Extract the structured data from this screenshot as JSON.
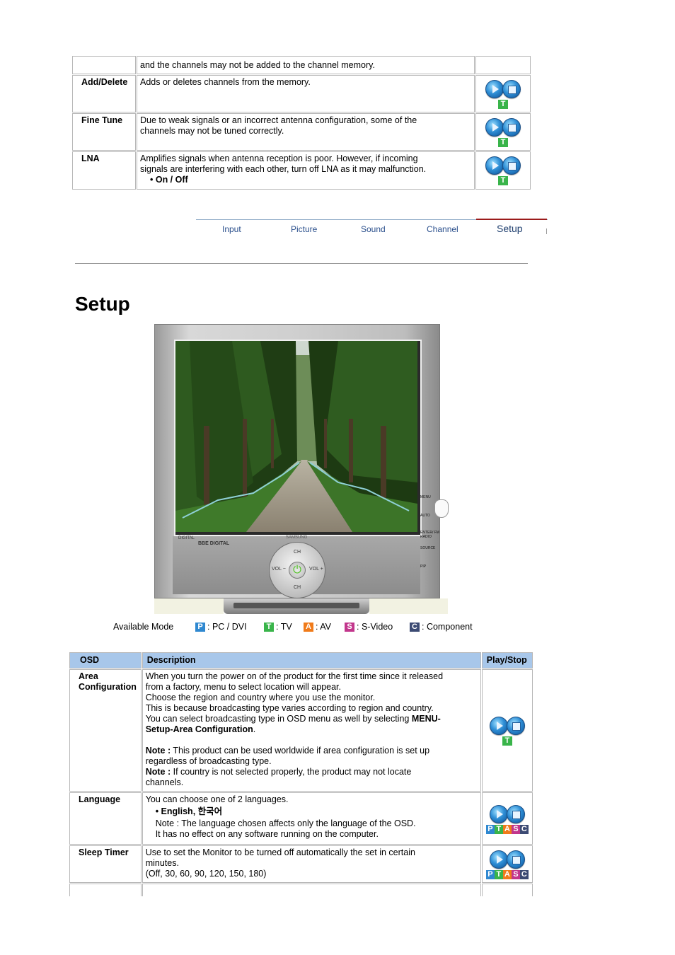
{
  "top_table": {
    "rows": [
      {
        "osd": "",
        "description": [
          "and the channels may not be added to the channel memory."
        ],
        "icons": false
      },
      {
        "osd": "Add/Delete",
        "description": [
          "Adds or deletes channels from the memory."
        ],
        "icons": true,
        "modes": [
          "T"
        ]
      },
      {
        "osd": "Fine Tune",
        "description": [
          "Due to weak signals or an incorrect antenna configuration, some of the",
          "channels may not be tuned correctly."
        ],
        "icons": true,
        "modes": [
          "T"
        ]
      },
      {
        "osd": "LNA",
        "description": [
          "Amplifies signals when antenna reception is poor. However, if incoming",
          "signals are interfering with each other, turn off LNA as it may malfunction."
        ],
        "bullet": "• On / Off",
        "icons": true,
        "modes": [
          "T"
        ]
      }
    ]
  },
  "nav": {
    "items": [
      "Input",
      "Picture",
      "Sound",
      "Channel",
      "Setup"
    ],
    "active": "Setup"
  },
  "page_title": "Setup",
  "monitor": {
    "side_buttons": [
      "MENU",
      "AUTO",
      "ENTER/ FM RADIO",
      "SOURCE",
      "PIP"
    ],
    "control_labels": {
      "ch": "CH",
      "vol_minus": "VOL −",
      "vol_plus": "VOL +"
    },
    "brand_text": "SAMSUNG",
    "logo_text": [
      "DIGITAL",
      "BBE DIGITAL"
    ]
  },
  "available_mode": {
    "label": "Available Mode",
    "modes": [
      {
        "letter": "P",
        "text": ": PC / DVI",
        "color": "#2f88d0"
      },
      {
        "letter": "T",
        "text": ": TV",
        "color": "#39b44a"
      },
      {
        "letter": "A",
        "text": ": AV",
        "color": "#f07b1a"
      },
      {
        "letter": "S",
        "text": ": S-Video",
        "color": "#c2368c"
      },
      {
        "letter": "C",
        "text": ": Component",
        "color": "#3c4a73"
      }
    ]
  },
  "setup_table": {
    "headers": [
      "OSD",
      "Description",
      "Play/Stop"
    ],
    "header_color": "#a8c7ea",
    "area": {
      "osd": [
        "Area",
        "Configuration"
      ],
      "lines": [
        "When you turn the power on of the product for the first time since it released",
        "from a factory, menu to select location will appear.",
        "Choose the region and country where you use the monitor.",
        "This is because broadcasting type varies according to region and country.",
        "You can select broadcasting type in OSD menu as well by selecting "
      ],
      "menu_path_1": "MENU-",
      "menu_path_2": "Setup-Area Configuration",
      "period": ".",
      "note1_label": "Note :",
      "note1_a": " This product can be used worldwide if area configuration is set up",
      "note1_b": "regardless of broadcasting type.",
      "note2_label": "Note :",
      "note2_a": " If country is not selected properly, the product may not locate",
      "note2_b": "channels.",
      "modes": "T"
    },
    "language": {
      "osd": "Language",
      "line": "You can choose one of 2 languages.",
      "bullet": "• English, 한국어",
      "note_a": "Note : The language chosen affects only the language of the OSD.",
      "note_b": "It has no effect on any software running on the computer.",
      "modes": [
        "P",
        "T",
        "A",
        "S",
        "C"
      ]
    },
    "sleep": {
      "osd": "Sleep Timer",
      "line_a": "Use to set the Monitor to be turned off automatically the set in certain",
      "line_b": "minutes.",
      "line_c": "(Off, 30, 60, 90, 120, 150, 180)",
      "modes": [
        "P",
        "T",
        "A",
        "S",
        "C"
      ]
    }
  }
}
